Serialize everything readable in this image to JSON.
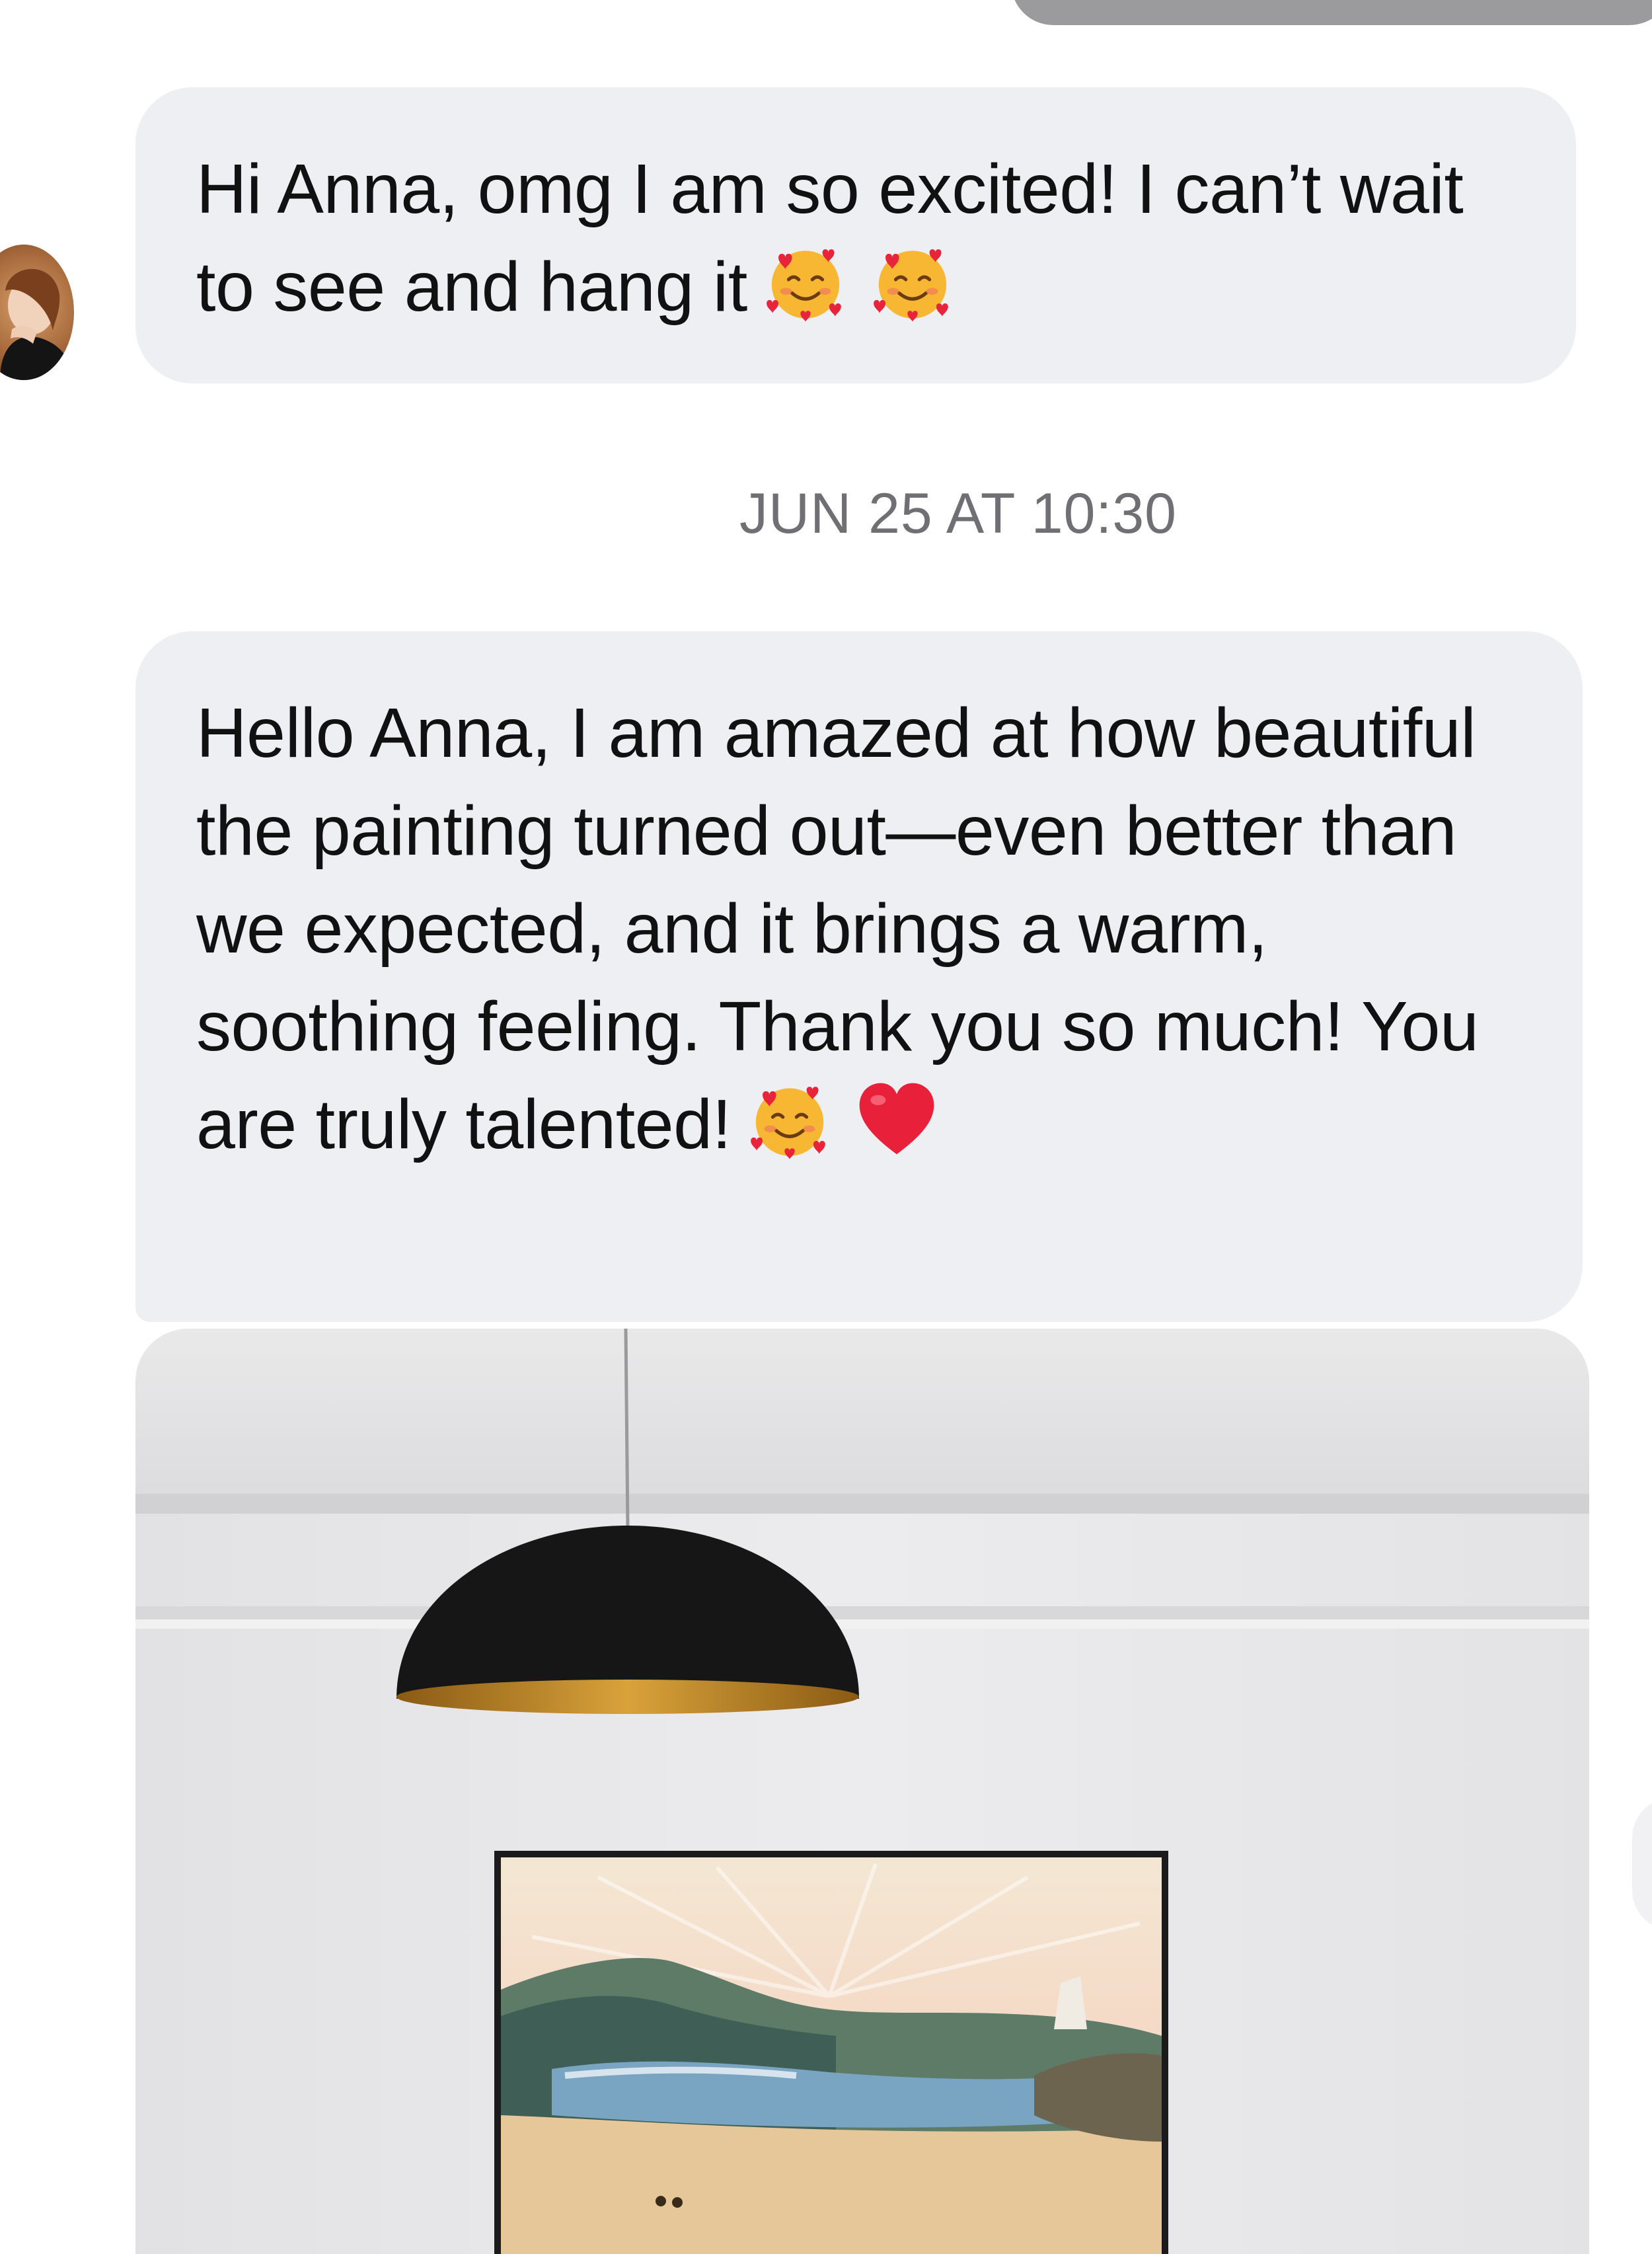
{
  "conversation": {
    "messages": [
      {
        "text": "Hi Anna, omg I am so excited! I can’t wait to see and hang it",
        "emojis": [
          "smiling-face-with-hearts",
          "smiling-face-with-hearts"
        ]
      },
      {
        "text": "Hello Anna, I am amazed at how beautiful the painting turned out—even better than we expected, and it brings a warm, soothing feeling. Thank you so much! You are truly talented!",
        "emojis": [
          "smiling-face-with-hearts",
          "red-heart"
        ]
      }
    ],
    "timestamp": "JUN 25 AT 10:30"
  },
  "colors": {
    "bubble": "#eeeff3",
    "timestamp": "#6f6f74"
  }
}
